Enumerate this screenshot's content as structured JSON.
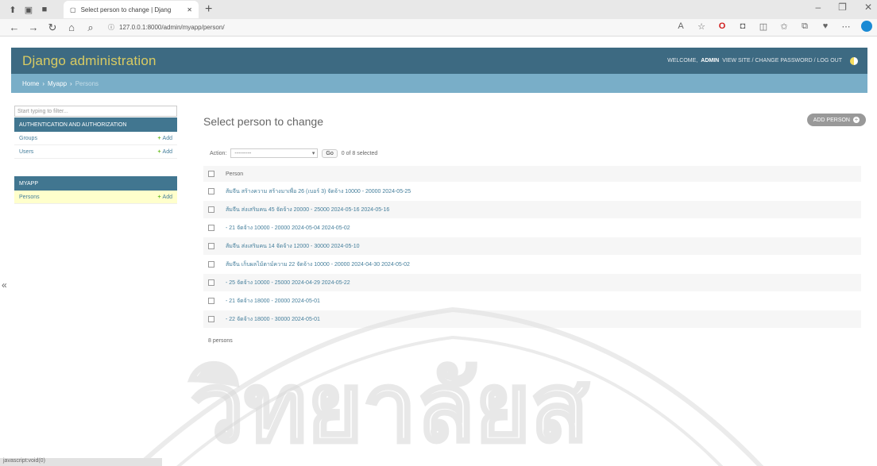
{
  "browser": {
    "tab_title": "Select person to change | Djang",
    "url": "127.0.0.1:8000/admin/myapp/person/"
  },
  "header": {
    "brand": "Django administration",
    "welcome": "WELCOME,",
    "user": "ADMIN",
    "links": "VIEW SITE / CHANGE PASSWORD / LOG OUT"
  },
  "breadcrumbs": {
    "home": "Home",
    "sep1": "›",
    "app": "Myapp",
    "sep2": "›",
    "current": "Persons"
  },
  "sidebar": {
    "filter_placeholder": "Start typing to filter...",
    "modules": [
      {
        "caption": "AUTHENTICATION AND AUTHORIZATION",
        "rows": [
          {
            "label": "Groups",
            "add": "Add"
          },
          {
            "label": "Users",
            "add": "Add"
          }
        ]
      },
      {
        "caption": "MYAPP",
        "rows": [
          {
            "label": "Persons",
            "add": "Add"
          }
        ]
      }
    ]
  },
  "content": {
    "title": "Select person to change",
    "add_button": "ADD PERSON",
    "action_label": "Action:",
    "action_value": "---------",
    "go": "Go",
    "selected": "0 of 8 selected",
    "column": "Person",
    "rows": [
      "ส้มจีน สร้างความ สร้างมาเพื่อ 26 (เบอร์ 3) จัดจ้าง 10000 - 20000 2024-05-25",
      "ส้มจีน ส่งเสริมคน 45 จัดจ้าง 20000 - 25000 2024-05-16 2024-05-16",
      "- 21 จัดจ้าง 10000 - 20000 2024-05-04 2024-05-02",
      "ส้มจีน ส่งเสริมคน 14 จัดจ้าง 12000 - 30000 2024-05-10",
      "ส้มจีน เก็บผลไม้ตาม์ความ 22 จัดจ้าง 10000 - 20000 2024-04-30 2024-05-02",
      "- 25 จัดจ้าง 10000 - 25000 2024-04-29 2024-05-22",
      "- 21 จัดจ้าง 18000 - 20000 2024-05-01",
      "- 22 จัดจ้าง 18000 - 30000 2024-05-01"
    ],
    "paginator": "8 persons"
  },
  "watermark": {
    "text": "วิทยาลัยส"
  },
  "statusbar": {
    "text": "javascript:void(0)"
  },
  "colors": {
    "header_bg": "#3d6a82",
    "brand": "#f5dd5d",
    "breadcrumbs_bg": "#79aec8",
    "module_caption": "#417690",
    "link": "#447e9b",
    "selected_row": "#ffffcc"
  }
}
